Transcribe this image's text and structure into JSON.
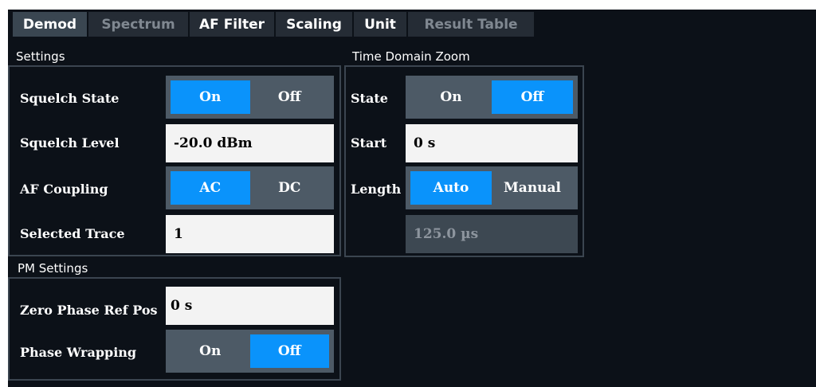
{
  "tabs": [
    {
      "label": "Demod",
      "state": "active"
    },
    {
      "label": "Spectrum",
      "state": "dimmed"
    },
    {
      "label": "AF Filter",
      "state": "normal"
    },
    {
      "label": "Scaling",
      "state": "normal"
    },
    {
      "label": "Unit",
      "state": "normal"
    },
    {
      "label": "Result Table",
      "state": "dimmed"
    }
  ],
  "settings": {
    "title": "Settings",
    "squelch_state": {
      "label": "Squelch State",
      "on": "On",
      "off": "Off",
      "selected": "On"
    },
    "squelch_level": {
      "label": "Squelch Level",
      "value": "-20.0 dBm"
    },
    "af_coupling": {
      "label": "AF Coupling",
      "ac": "AC",
      "dc": "DC",
      "selected": "AC"
    },
    "selected_trace": {
      "label": "Selected Trace",
      "value": "1"
    }
  },
  "time_domain_zoom": {
    "title": "Time Domain Zoom",
    "state": {
      "label": "State",
      "on": "On",
      "off": "Off",
      "selected": "Off"
    },
    "start": {
      "label": "Start",
      "value": "0 s"
    },
    "length": {
      "label": "Length",
      "auto": "Auto",
      "manual": "Manual",
      "selected": "Auto",
      "value": "125.0 µs"
    }
  },
  "pm_settings": {
    "title": "PM Settings",
    "zero_phase_ref_pos": {
      "label": "Zero Phase Ref Pos",
      "value": "0 s"
    },
    "phase_wrapping": {
      "label": "Phase Wrapping",
      "on": "On",
      "off": "Off",
      "selected": "Off"
    }
  },
  "colors": {
    "accent": "#0a93fb",
    "background": "#0c1118",
    "toggle_bg": "#4d5a66",
    "field_bg": "#f3f3f3"
  }
}
